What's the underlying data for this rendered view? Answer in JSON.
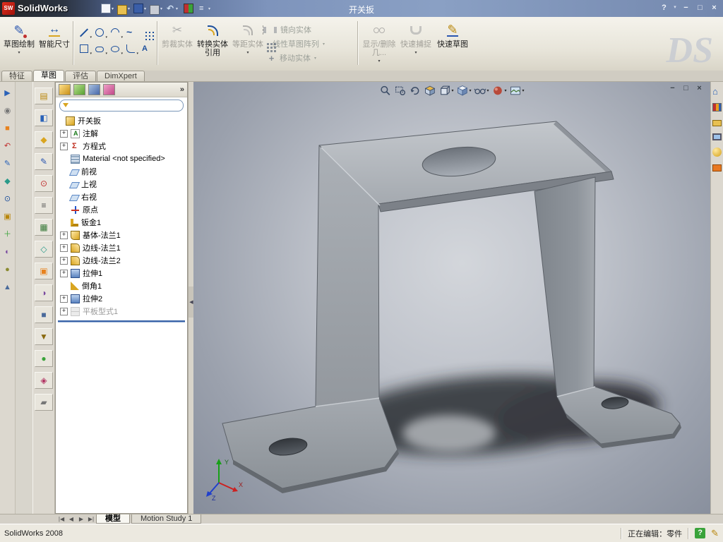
{
  "colors": {
    "brand_red": "#cc1c1c",
    "titlebar_blue": "#7e96c0",
    "accent_blue": "#1c4f9c",
    "rollback_blue": "#3a64a8",
    "help_green": "#3aa33a"
  },
  "titlebar": {
    "app_name": "SolidWorks",
    "document_title": "开关扳",
    "controls": {
      "help": "?",
      "minimize": "−",
      "maximize": "□",
      "close": "×"
    }
  },
  "command_tabs": {
    "features": "特征",
    "sketch": "草图",
    "evaluate": "评估",
    "dimxpert": "DimXpert"
  },
  "toolbar": {
    "sketch": "草图绘制",
    "smart_dimension": "智能尺寸",
    "trim_entities": "剪裁实体",
    "convert_entities": "转换实体引用",
    "offset_entities": "等距实体",
    "mirror_entities": "镜向实体",
    "linear_sketch_pattern": "线性草图阵列",
    "move_entities": "移动实体",
    "display_delete_relations": "显示/删除几...",
    "quick_snaps": "快速捕捉",
    "rapid_sketch": "快速草图",
    "watermark": "DS"
  },
  "feature_tree": {
    "header_more": "»",
    "items": [
      {
        "label": "开关扳"
      },
      {
        "label": "注解"
      },
      {
        "label": "方程式"
      },
      {
        "label": "Material <not specified>"
      },
      {
        "label": "前视"
      },
      {
        "label": "上视"
      },
      {
        "label": "右视"
      },
      {
        "label": "原点"
      },
      {
        "label": "钣金1"
      },
      {
        "label": "基体-法兰1"
      },
      {
        "label": "边线-法兰1"
      },
      {
        "label": "边线-法兰2"
      },
      {
        "label": "拉伸1"
      },
      {
        "label": "倒角1"
      },
      {
        "label": "拉伸2"
      },
      {
        "label": "平板型式1"
      }
    ]
  },
  "viewport": {
    "window_controls": {
      "minimize": "−",
      "restore": "□",
      "close": "×"
    },
    "triad": {
      "x": "X",
      "y": "Y",
      "z": "Z"
    }
  },
  "bottom_tabs": {
    "nav": {
      "first": "|◀",
      "prev": "◀",
      "next": "▶",
      "last": "▶|"
    },
    "model": "模型",
    "motion_study": "Motion Study 1"
  },
  "statusbar": {
    "app_version": "SolidWorks 2008",
    "editing_status": "正在编辑：零件",
    "help_glyph": "?"
  }
}
